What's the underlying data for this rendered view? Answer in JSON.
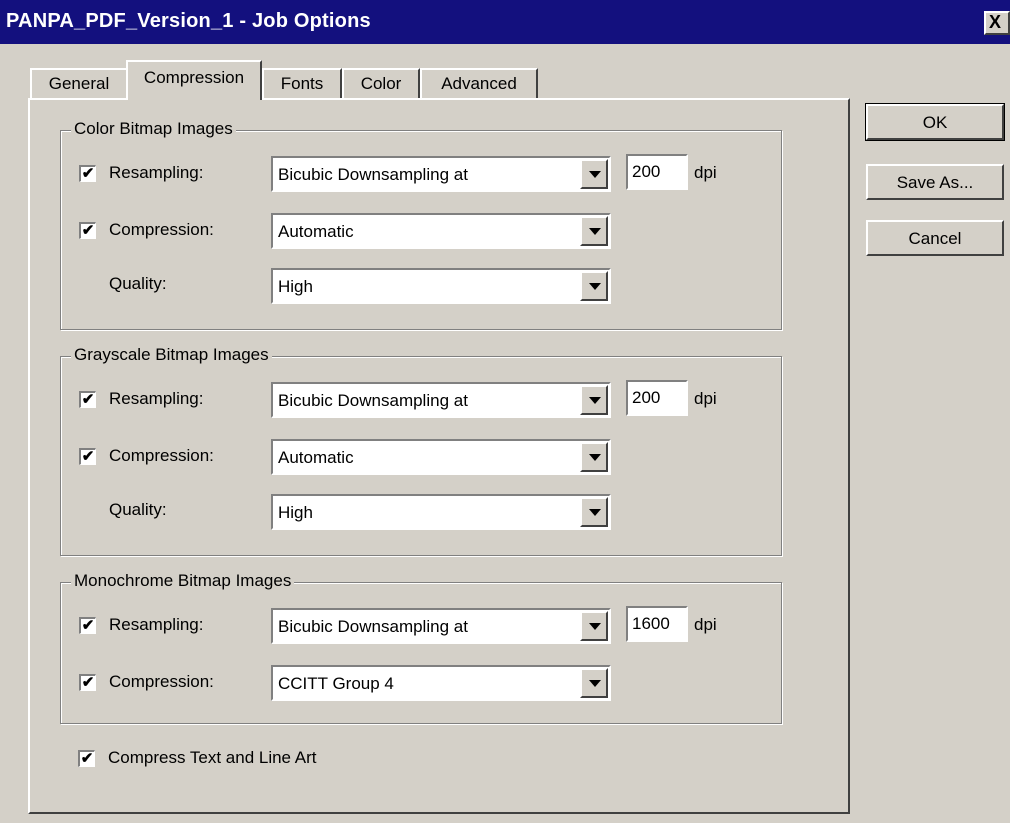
{
  "title": "PANPA_PDF_Version_1 - Job Options",
  "close_label": "X",
  "tabs": [
    {
      "label": "General"
    },
    {
      "label": "Compression"
    },
    {
      "label": "Fonts"
    },
    {
      "label": "Color"
    },
    {
      "label": "Advanced"
    }
  ],
  "active_tab": "Compression",
  "buttons": {
    "ok": "OK",
    "save_as": "Save As...",
    "cancel": "Cancel"
  },
  "color_group": {
    "legend": "Color Bitmap Images",
    "resampling_label": "Resampling:",
    "resampling_checked": true,
    "resampling_value": "Bicubic Downsampling at",
    "dpi_value": "200",
    "dpi_unit": "dpi",
    "compression_label": "Compression:",
    "compression_checked": true,
    "compression_value": "Automatic",
    "quality_label": "Quality:",
    "quality_value": "High"
  },
  "gray_group": {
    "legend": "Grayscale Bitmap Images",
    "resampling_label": "Resampling:",
    "resampling_checked": true,
    "resampling_value": "Bicubic Downsampling at",
    "dpi_value": "200",
    "dpi_unit": "dpi",
    "compression_label": "Compression:",
    "compression_checked": true,
    "compression_value": "Automatic",
    "quality_label": "Quality:",
    "quality_value": "High"
  },
  "mono_group": {
    "legend": "Monochrome Bitmap Images",
    "resampling_label": "Resampling:",
    "resampling_checked": true,
    "resampling_value": "Bicubic Downsampling at",
    "dpi_value": "1600",
    "dpi_unit": "dpi",
    "compression_label": "Compression:",
    "compression_checked": true,
    "compression_value": "CCITT Group 4"
  },
  "compress_text": {
    "label": "Compress Text and Line Art",
    "checked": true
  },
  "check_glyph": "✔",
  "colors": {
    "titlebar": "#13107e",
    "face": "#d4d0c8"
  }
}
